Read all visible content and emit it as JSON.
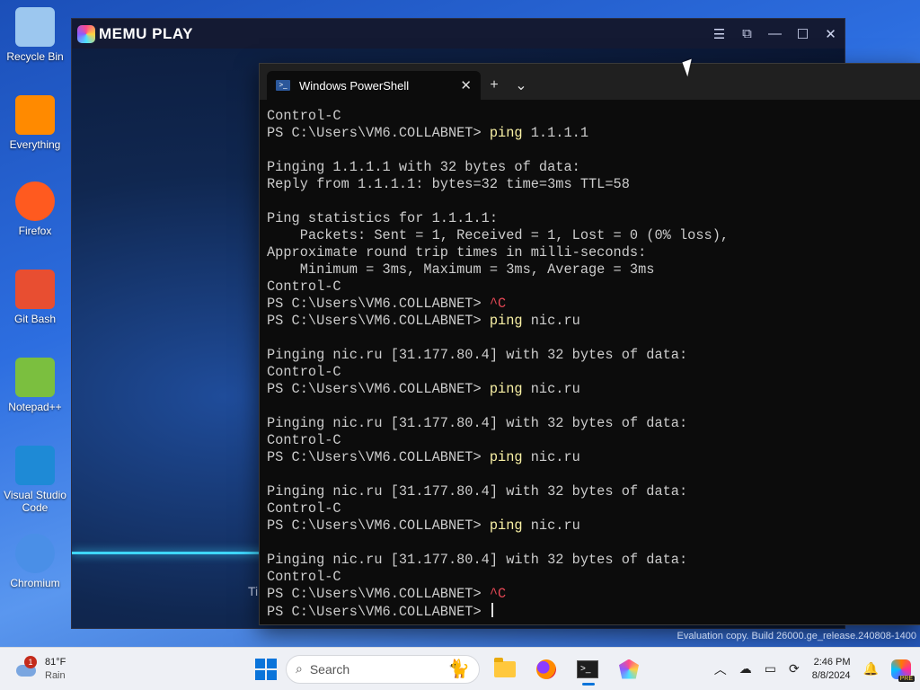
{
  "desktop": {
    "icons": [
      {
        "label": "Recycle Bin",
        "icon": "recycle-bin-icon"
      },
      {
        "label": "Everything",
        "icon": "search-magnifier-icon"
      },
      {
        "label": "Firefox",
        "icon": "firefox-icon"
      },
      {
        "label": "Git Bash",
        "icon": "git-bash-icon"
      },
      {
        "label": "Notepad++",
        "icon": "notepad-plus-plus-icon"
      },
      {
        "label": "Visual Studio Code",
        "icon": "vscode-icon"
      },
      {
        "label": "Chromium",
        "icon": "chromium-icon"
      }
    ]
  },
  "memu": {
    "title": "MEMU PLAY",
    "controls": [
      "menu-icon",
      "screen-icon",
      "minimize-icon",
      "maximize-icon",
      "close-icon"
    ],
    "partial_text": "Ti"
  },
  "terminal": {
    "tab_title": "Windows PowerShell",
    "tab_close": "✕",
    "new_tab": "+",
    "dropdown": "⌄",
    "prompt": "PS C:\\Users\\VM6.COLLABNET> ",
    "lines": [
      {
        "type": "out",
        "text": "Control-C"
      },
      {
        "type": "cmd",
        "cmd": "ping",
        "arg": " 1.1.1.1"
      },
      {
        "type": "out",
        "text": ""
      },
      {
        "type": "out",
        "text": "Pinging 1.1.1.1 with 32 bytes of data:"
      },
      {
        "type": "out",
        "text": "Reply from 1.1.1.1: bytes=32 time=3ms TTL=58"
      },
      {
        "type": "out",
        "text": ""
      },
      {
        "type": "out",
        "text": "Ping statistics for 1.1.1.1:"
      },
      {
        "type": "out",
        "text": "    Packets: Sent = 1, Received = 1, Lost = 0 (0% loss),"
      },
      {
        "type": "out",
        "text": "Approximate round trip times in milli-seconds:"
      },
      {
        "type": "out",
        "text": "    Minimum = 3ms, Maximum = 3ms, Average = 3ms"
      },
      {
        "type": "out",
        "text": "Control-C"
      },
      {
        "type": "ctrlc",
        "text": "^C"
      },
      {
        "type": "cmd",
        "cmd": "ping",
        "arg": " nic.ru"
      },
      {
        "type": "out",
        "text": ""
      },
      {
        "type": "out",
        "text": "Pinging nic.ru [31.177.80.4] with 32 bytes of data:"
      },
      {
        "type": "out",
        "text": "Control-C"
      },
      {
        "type": "cmd",
        "cmd": "ping",
        "arg": " nic.ru"
      },
      {
        "type": "out",
        "text": ""
      },
      {
        "type": "out",
        "text": "Pinging nic.ru [31.177.80.4] with 32 bytes of data:"
      },
      {
        "type": "out",
        "text": "Control-C"
      },
      {
        "type": "cmd",
        "cmd": "ping",
        "arg": " nic.ru"
      },
      {
        "type": "out",
        "text": ""
      },
      {
        "type": "out",
        "text": "Pinging nic.ru [31.177.80.4] with 32 bytes of data:"
      },
      {
        "type": "out",
        "text": "Control-C"
      },
      {
        "type": "cmd",
        "cmd": "ping",
        "arg": " nic.ru"
      },
      {
        "type": "out",
        "text": ""
      },
      {
        "type": "out",
        "text": "Pinging nic.ru [31.177.80.4] with 32 bytes of data:"
      },
      {
        "type": "out",
        "text": "Control-C"
      },
      {
        "type": "ctrlc",
        "text": "^C"
      },
      {
        "type": "prompt"
      }
    ],
    "colors": {
      "command": "#f9f1a5",
      "ctrl_c": "#e74856",
      "text": "#cccccc",
      "background": "#0c0c0c"
    }
  },
  "watermark": "Evaluation copy. Build 26000.ge_release.240808-1400",
  "taskbar": {
    "weather": {
      "temp": "81°F",
      "condition": "Rain",
      "badge": "1"
    },
    "search_placeholder": "Search",
    "apps": [
      "file-explorer-icon",
      "firefox-icon",
      "terminal-icon",
      "memu-icon"
    ],
    "clock": {
      "time": "2:46 PM",
      "date": "8/8/2024"
    },
    "tray_icons": [
      "chevron-up-icon",
      "network-icon",
      "display-icon",
      "sync-icon",
      "bell-icon",
      "copilot-icon"
    ],
    "copilot_badge": "PRE"
  }
}
